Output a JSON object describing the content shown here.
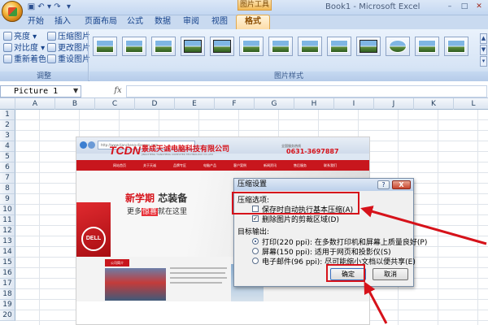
{
  "window": {
    "title": "Book1 - Microsoft Excel",
    "tools_context_label": "图片工具"
  },
  "quick_access": {
    "save_icon": "save-icon",
    "undo_icon": "undo-icon",
    "redo_icon": "redo-icon",
    "more_icon": "dropdown-icon"
  },
  "tabs": [
    {
      "label": "开始"
    },
    {
      "label": "插入"
    },
    {
      "label": "页面布局"
    },
    {
      "label": "公式"
    },
    {
      "label": "数据"
    },
    {
      "label": "审阅"
    },
    {
      "label": "视图"
    },
    {
      "label": "格式"
    }
  ],
  "ribbon": {
    "adjust_group": {
      "label": "调整",
      "brightness": "亮度",
      "contrast": "对比度",
      "recolor": "重新着色",
      "compress": "压缩图片",
      "change": "更改图片",
      "reset": "重设图片"
    },
    "styles_group": {
      "label": "图片样式",
      "style_count": 13
    }
  },
  "formula_bar": {
    "name_box": "Picture 1",
    "fx_label": "fx",
    "formula": ""
  },
  "columns": [
    "A",
    "B",
    "C",
    "D",
    "E",
    "F",
    "G",
    "H",
    "I",
    "J",
    "K",
    "L"
  ],
  "rows": [
    "1",
    "2",
    "3",
    "4",
    "5",
    "6",
    "7",
    "8",
    "9",
    "10",
    "11",
    "12",
    "13",
    "14",
    "15",
    "16",
    "17",
    "18",
    "19",
    "20"
  ],
  "picture": {
    "address": "http://www.tiancheng-diannao.com",
    "logo": "TCDN",
    "company": "景成天诚电脑科技有限公司",
    "company_en": "JINGCHENG TIANCHENG COMPUTER TECHNOLOGY CO.,LTD",
    "hotline_label": "全国服务热线",
    "phone": "0631-3697887",
    "nav": [
      "网站首页",
      "关于天诚",
      "品牌专区",
      "电脑产品",
      "客户案例",
      "新闻资讯",
      "售后服务",
      "联系我们"
    ],
    "banner_line1_red": "新学期",
    "banner_line1_dark": "芯装备",
    "banner_line2_pre": "更多",
    "banner_line2_hl": "惊喜",
    "banner_line2_post": "就在这里",
    "banner_logo": "DELL",
    "news_tab": "公司简介"
  },
  "dialog": {
    "title": "压缩设置",
    "help": "?",
    "close": "X",
    "compress_options_label": "压缩选项:",
    "auto_compress": {
      "label": "保存时自动执行基本压缩(A)",
      "checked": false
    },
    "delete_crop": {
      "label": "删除图片的剪裁区域(D)",
      "checked": true
    },
    "target_label": "目标输出:",
    "targets": [
      {
        "label": "打印(220 ppi): 在多数打印机和屏幕上质量良好(P)",
        "selected": true
      },
      {
        "label": "屏幕(150 ppi): 适用于网页和投影仪(S)",
        "selected": false
      },
      {
        "label": "电子邮件(96 ppi): 尽可能缩小文档以便共享(E)",
        "selected": false
      }
    ],
    "ok": "确定",
    "cancel": "取消"
  },
  "colors": {
    "highlight": "#d6121a",
    "ribbon": "#d6e4f5",
    "format_tab": "#fcdba5"
  }
}
